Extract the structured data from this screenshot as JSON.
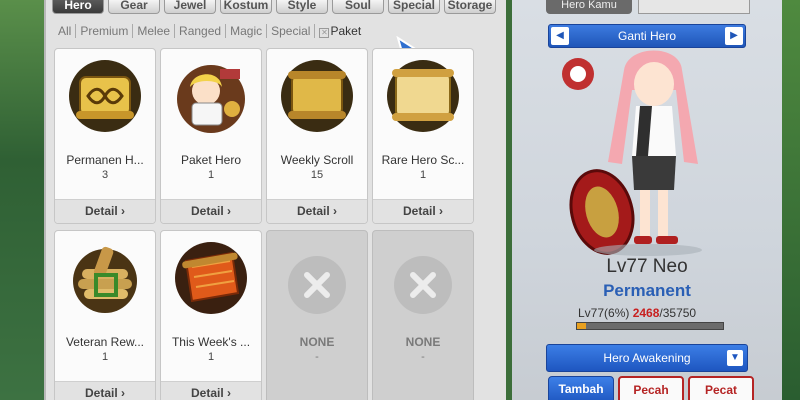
{
  "tabs": [
    "Hero",
    "Gear",
    "Jewel",
    "Kostum",
    "Style",
    "Soul",
    "Special",
    "Storage"
  ],
  "active_tab": "Hero",
  "filters": [
    "All",
    "Premium",
    "Melee",
    "Ranged",
    "Magic",
    "Special",
    "Paket"
  ],
  "items": [
    {
      "name": "Permanen H...",
      "count": "3",
      "detail": "Detail",
      "icon": "scroll-infinity-icon"
    },
    {
      "name": "Paket Hero",
      "count": "1",
      "detail": "Detail",
      "icon": "hero-package-icon"
    },
    {
      "name": "Weekly Scroll",
      "count": "15",
      "detail": "Detail",
      "icon": "week-scroll-icon"
    },
    {
      "name": "Rare Hero Sc...",
      "count": "1",
      "detail": "Detail",
      "icon": "rare-scroll-icon"
    },
    {
      "name": "Veteran Rew...",
      "count": "1",
      "detail": "Detail",
      "icon": "scroll-bundle-icon"
    },
    {
      "name": "This Week's ...",
      "count": "1",
      "detail": "Detail",
      "icon": "red-scroll-icon"
    },
    {
      "name": "NONE",
      "count": "-",
      "empty": true
    },
    {
      "name": "NONE",
      "count": "-",
      "empty": true
    }
  ],
  "hero_panel": {
    "tab_label": "Hero Kamu",
    "switch_label": "Ganti Hero",
    "level_name": "Lv77 Neo",
    "status": "Permanent",
    "exp_prefix": "Lv77(6%)",
    "exp_current": "2468",
    "exp_total": "/35750",
    "exp_fraction": 0.06,
    "awakening_label": "Hero Awakening",
    "buttons": [
      "Tambah",
      "Pecah",
      "Pecat"
    ]
  },
  "colors": {
    "accent_blue": "#2a5fb5",
    "exp_red": "#c82020"
  }
}
